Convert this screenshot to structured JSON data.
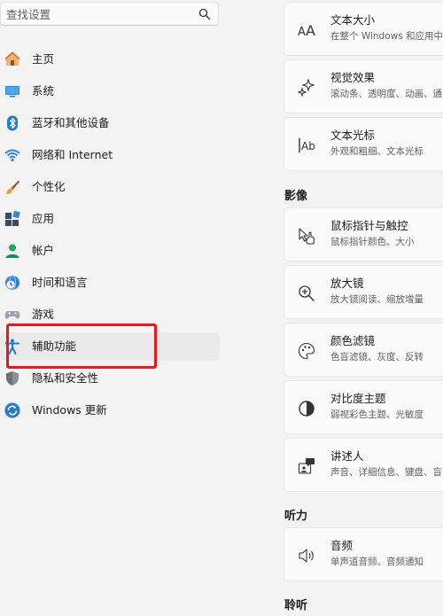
{
  "search": {
    "placeholder": "查找设置"
  },
  "sidebar": {
    "items": [
      {
        "label": "主页",
        "icon": "home-icon"
      },
      {
        "label": "系统",
        "icon": "display-icon"
      },
      {
        "label": "蓝牙和其他设备",
        "icon": "bluetooth-icon"
      },
      {
        "label": "网络和 Internet",
        "icon": "wifi-icon"
      },
      {
        "label": "个性化",
        "icon": "brush-icon"
      },
      {
        "label": "应用",
        "icon": "apps-icon"
      },
      {
        "label": "帐户",
        "icon": "account-icon"
      },
      {
        "label": "时间和语言",
        "icon": "globe-clock-icon"
      },
      {
        "label": "游戏",
        "icon": "gamepad-icon"
      },
      {
        "label": "辅助功能",
        "icon": "accessibility-icon",
        "selected": true
      },
      {
        "label": "隐私和安全性",
        "icon": "shield-icon"
      },
      {
        "label": "Windows 更新",
        "icon": "update-icon"
      }
    ]
  },
  "main": {
    "cards": [
      {
        "title": "文本大小",
        "subtitle": "在整个 Windows 和应用中",
        "icon": "text-size-icon"
      },
      {
        "title": "视觉效果",
        "subtitle": "滚动条、透明度、动画、通",
        "icon": "sparkle-icon"
      },
      {
        "title": "文本光标",
        "subtitle": "外观和粗细、文本光标",
        "icon": "text-cursor-icon"
      },
      {
        "title": "鼠标指针与触控",
        "subtitle": "鼠标指针颜色、大小",
        "icon": "pointer-touch-icon"
      },
      {
        "title": "放大镜",
        "subtitle": "放大镜阅读、缩放增量",
        "icon": "magnifier-icon"
      },
      {
        "title": "颜色滤镜",
        "subtitle": "色盲滤镜、灰度、反转",
        "icon": "palette-icon"
      },
      {
        "title": "对比度主题",
        "subtitle": "弱视彩色主题、光敏度",
        "icon": "contrast-icon"
      },
      {
        "title": "讲述人",
        "subtitle": "声音、详细信息、键盘、盲",
        "icon": "narrator-icon"
      },
      {
        "title": "音频",
        "subtitle": "单声道音频、音频通知",
        "icon": "speaker-icon"
      }
    ],
    "sections": {
      "vision": "影像",
      "hearing": "听力",
      "listening": "聆听"
    }
  },
  "colors": {
    "highlight": "#e8191e",
    "accent": "#0067c0"
  }
}
